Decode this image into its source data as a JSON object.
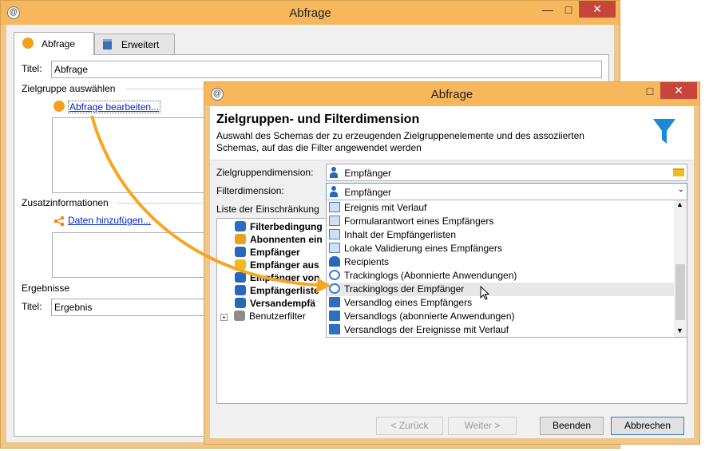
{
  "main_window": {
    "title": "Abfrage",
    "app_icon_glyph": "@",
    "tabs": [
      {
        "label": "Abfrage",
        "icon": "orange-circle-icon"
      },
      {
        "label": "Erweitert",
        "icon": "clipboard-icon"
      }
    ],
    "titel_label": "Titel:",
    "titel_value": "Abfrage",
    "zielgruppe_section": "Zielgruppe auswählen",
    "edit_query_link": "Abfrage bearbeiten...",
    "zusatz_section": "Zusatzinformationen",
    "add_data_link": "Daten hinzufügen...",
    "ergebnisse_section": "Ergebnisse",
    "result_title_label": "Titel:",
    "result_title_value": "Ergebnis"
  },
  "dialog": {
    "title": "Abfrage",
    "app_icon_glyph": "@",
    "heading": "Zielgruppen- und Filterdimension",
    "description_line1": "Auswahl des Schemas der zu erzeugenden Zielgruppenelemente und des assoziierten",
    "description_line2": "Schemas, auf das die Filter angewendet werden",
    "target_dimension_label": "Zielgruppendimension:",
    "target_dimension_value": "Empfänger",
    "filter_dimension_label": "Filterdimension:",
    "filter_dimension_value": "Empfänger",
    "restrictions_label": "Liste der Einschränkung",
    "tree_items": [
      {
        "label": "Filterbedingung",
        "bold": true,
        "icon": "filter-conditions-icon",
        "color": "#2b6cc4"
      },
      {
        "label": "Abonnenten ein",
        "bold": true,
        "icon": "subscribers-icon",
        "color": "#e8a21b"
      },
      {
        "label": "Empfänger",
        "bold": true,
        "icon": "recipient-icon",
        "color": "#2768b8"
      },
      {
        "label": "Empfänger aus",
        "bold": true,
        "icon": "folder-icon",
        "color": "#f0bc18"
      },
      {
        "label": "Empfänger von",
        "bold": true,
        "icon": "lifebuoy-icon",
        "color": "#2768b8"
      },
      {
        "label": "Empfängerliste",
        "bold": true,
        "icon": "recipient-list-icon",
        "color": "#2768b8"
      },
      {
        "label": "Versandempfä",
        "bold": true,
        "icon": "envelope-icon",
        "color": "#2768b8"
      },
      {
        "label": "Benutzerfilter",
        "bold": false,
        "icon": "funnel-icon",
        "color": "#8c8c8c"
      }
    ],
    "dropdown_items": [
      {
        "label": "Ereignis mit Verlauf",
        "icon": "document-icon"
      },
      {
        "label": "Formularantwort eines Empfängers",
        "icon": "form-response-icon"
      },
      {
        "label": "Inhalt der Empfängerlisten",
        "icon": "list-content-icon"
      },
      {
        "label": "Lokale Validierung eines Empfängers",
        "icon": "document-icon"
      },
      {
        "label": "Recipients",
        "icon": "recipient-icon"
      },
      {
        "label": "Trackinglogs (Abonnierte Anwendungen)",
        "icon": "tracking-link-icon"
      },
      {
        "label": "Trackinglogs der Empfänger",
        "icon": "tracking-link-icon"
      },
      {
        "label": "Versandlog eines Empfängers",
        "icon": "envelope-icon"
      },
      {
        "label": "Versandlogs (abonnierte Anwendungen)",
        "icon": "envelope-icon"
      },
      {
        "label": "Versandlogs der Ereignisse mit Verlauf",
        "icon": "envelope-icon"
      }
    ],
    "hover_index": 6,
    "buttons": {
      "back": "< Zurück",
      "next": "Weiter >",
      "finish": "Beenden",
      "cancel": "Abbrechen"
    }
  },
  "colors": {
    "titlebar": "#f7b75c",
    "close": "#c7453b",
    "link": "#0026c6",
    "arrow": "#f5a623",
    "filter_icon": "#1b8ad4"
  }
}
